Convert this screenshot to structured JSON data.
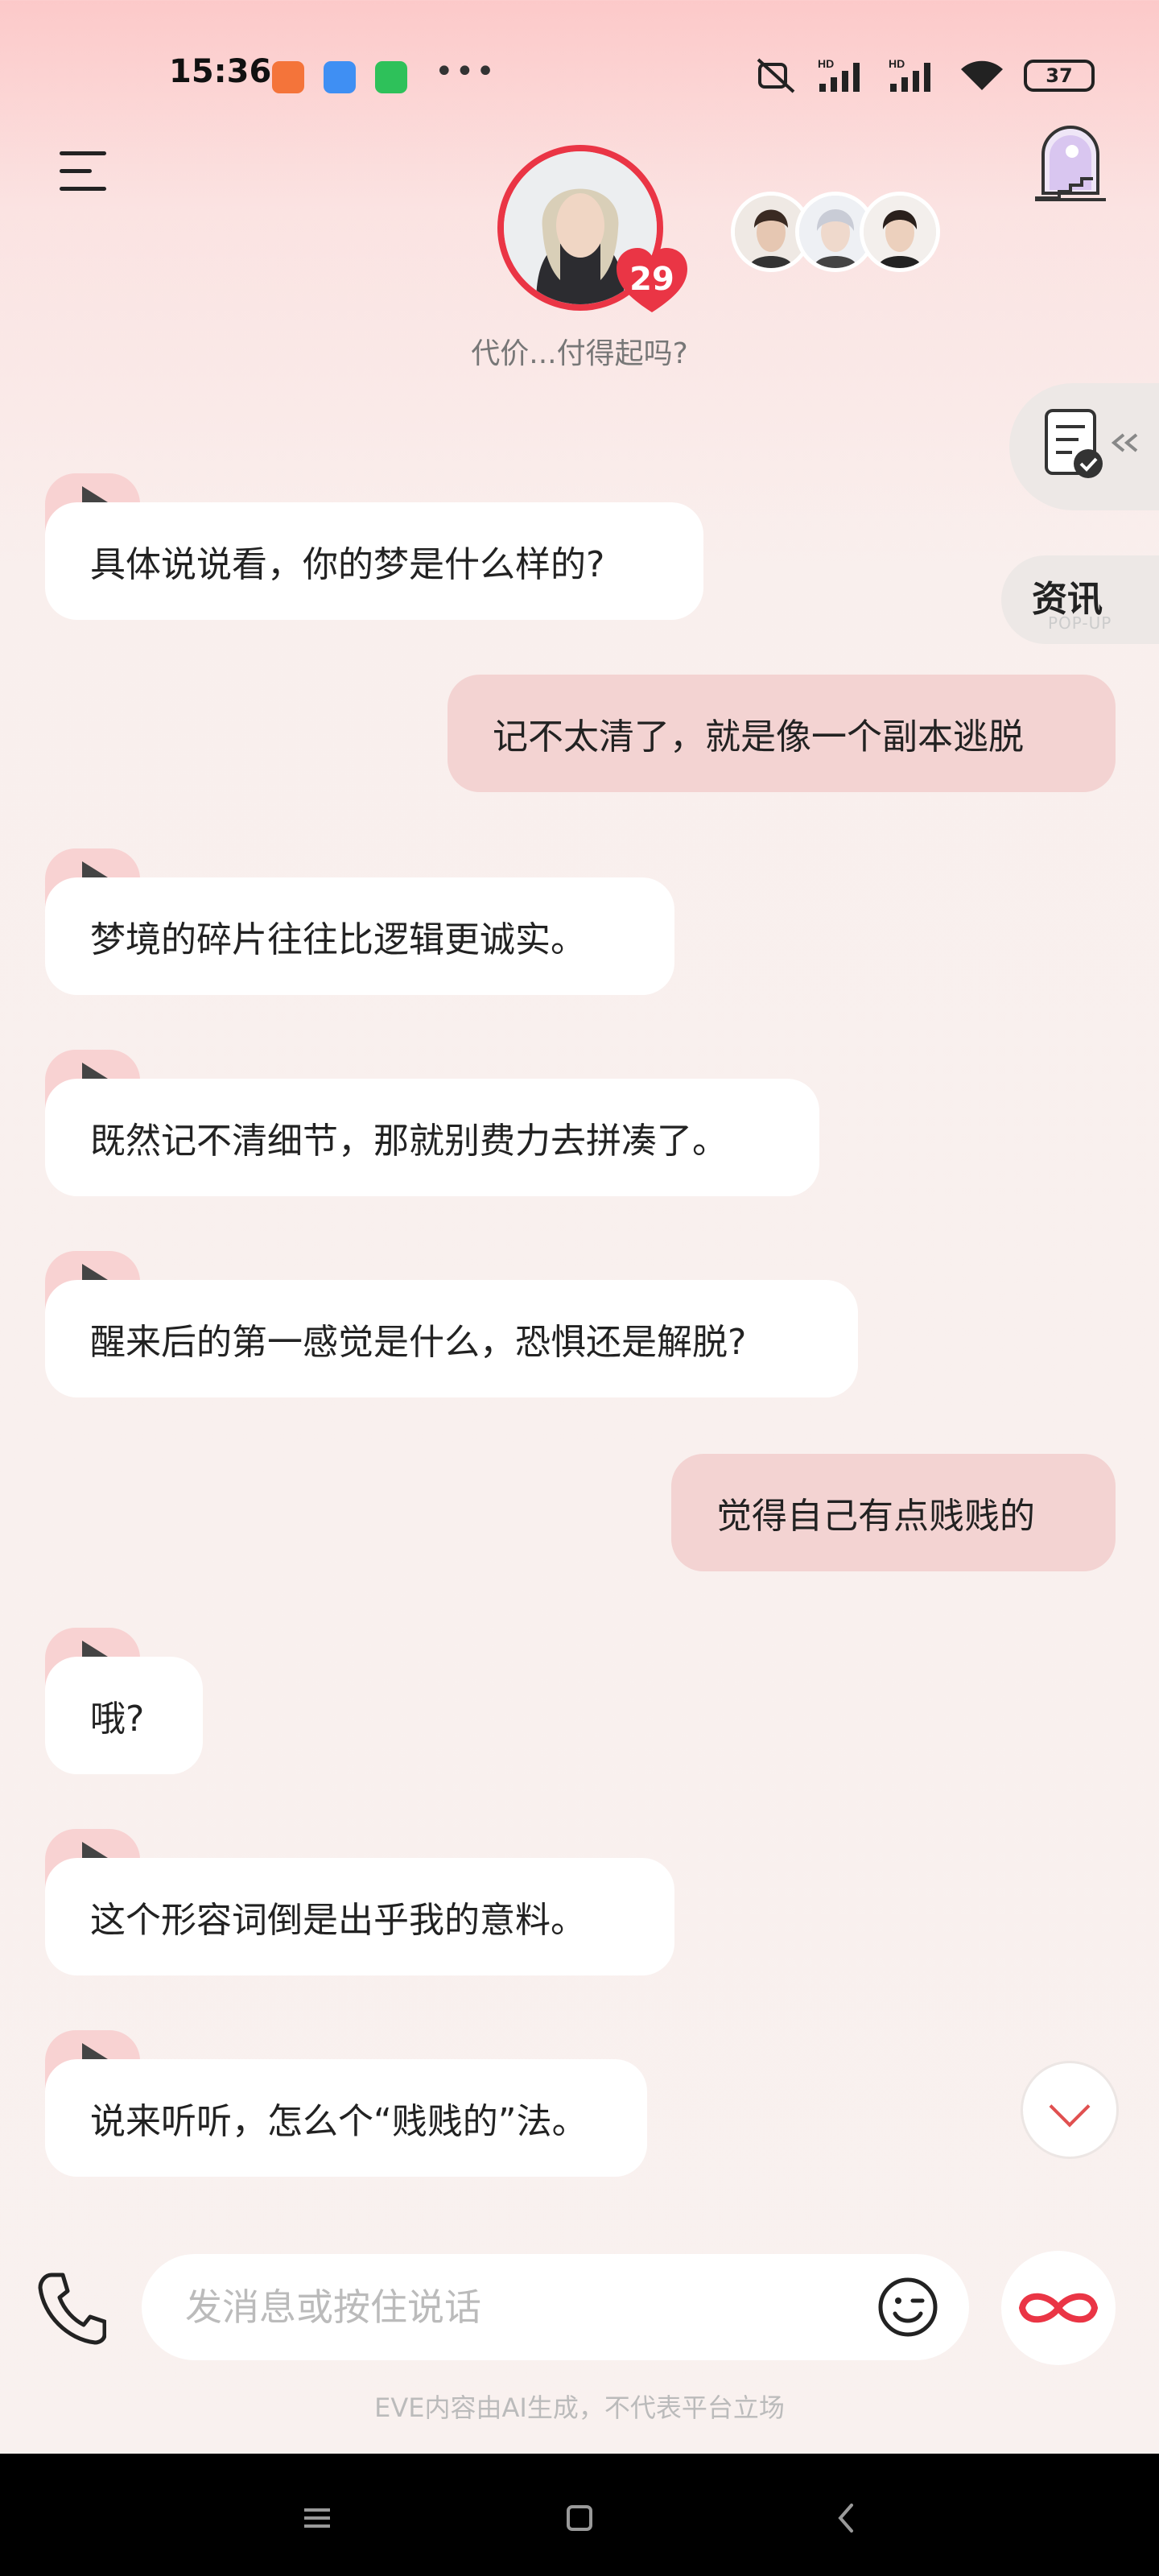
{
  "status_bar": {
    "time": "15:36",
    "battery": "37",
    "overflow_dots": "•••",
    "signal_label_1": "HD",
    "signal_label_2": "HD"
  },
  "header": {
    "affection_level": "29",
    "subtitle": "代价...付得起吗?"
  },
  "side": {
    "news_label": "资讯",
    "news_sub": "POP-UP"
  },
  "messages": [
    {
      "role": "ai",
      "text": "具体说说看，你的梦是什么样的?"
    },
    {
      "role": "user",
      "text": "记不太清了，就是像一个副本逃脱"
    },
    {
      "role": "ai",
      "text": "梦境的碎片往往比逻辑更诚实。"
    },
    {
      "role": "ai",
      "text": "既然记不清细节，那就别费力去拼凑了。"
    },
    {
      "role": "ai",
      "text": "醒来后的第一感觉是什么，恐惧还是解脱?"
    },
    {
      "role": "user",
      "text": "觉得自己有点贱贱的"
    },
    {
      "role": "ai",
      "text": "哦?"
    },
    {
      "role": "ai",
      "text": "这个形容词倒是出乎我的意料。"
    },
    {
      "role": "ai",
      "text": "说来听听，怎么个“贱贱的”法。"
    }
  ],
  "input": {
    "placeholder": "发消息或按住说话",
    "value": ""
  },
  "disclaimer": "EVE内容由AI生成，不代表平台立场",
  "icons": {
    "menu": "menu-icon",
    "tower": "tower-window-icon",
    "todo": "checklist-icon",
    "phone": "phone-icon",
    "emoji": "emoji-wink-icon",
    "infinity": "infinity-icon"
  },
  "colors": {
    "accent_red": "#ea3545",
    "user_bubble": "#f3d3d2",
    "play_tab": "#f8d2d2"
  }
}
